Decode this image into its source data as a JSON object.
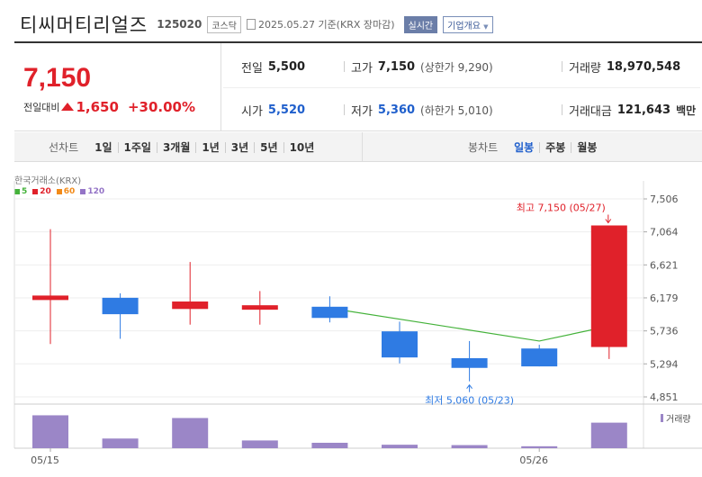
{
  "header": {
    "title": "티씨머티리얼즈",
    "code": "125020",
    "market": "코스닥",
    "date_text": "2025.05.27 기준(KRX 장마감)",
    "realtime_label": "실시간",
    "company_label": "기업개요"
  },
  "summary": {
    "price": "7,150",
    "change_label": "전일대비",
    "change_value": "1,650",
    "change_pct": "+30.00%",
    "prev_close_label": "전일",
    "prev_close": "5,500",
    "open_label": "시가",
    "open": "5,520",
    "high_label": "고가",
    "high": "7,150",
    "upper_limit": "(상한가 9,290)",
    "low_label": "저가",
    "low": "5,360",
    "lower_limit": "(하한가 5,010)",
    "volume_label": "거래량",
    "volume": "18,970,548",
    "amount_label": "거래대금",
    "amount": "121,643",
    "amount_unit": "백만"
  },
  "toolbar": {
    "line_label": "선차트",
    "line_items": [
      "1일",
      "1주일",
      "3개월",
      "1년",
      "3년",
      "5년",
      "10년"
    ],
    "candle_label": "봉차트",
    "candle_items": [
      "일봉",
      "주봉",
      "월봉"
    ],
    "candle_active": "일봉"
  },
  "colors": {
    "up": "#e0212a",
    "down": "#2f7be3",
    "ma5": "#44b23a",
    "ma20": "#e0212a",
    "ma60": "#f28a18",
    "ma120": "#9474c6",
    "volume": "#9b86c7"
  },
  "chart_data": {
    "type": "candlestick",
    "source_label": "한국거래소(KRX)",
    "ma_legend": [
      "5",
      "20",
      "60",
      "120"
    ],
    "volume_legend": "거래량",
    "y_ticks": [
      "7,506",
      "7,064",
      "6,621",
      "6,179",
      "5,736",
      "5,294",
      "4,851"
    ],
    "ylim": [
      4851,
      7506
    ],
    "x_labels": [
      {
        "index": 0,
        "label": "05/15"
      },
      {
        "index": 7,
        "label": "05/26"
      }
    ],
    "candles": [
      {
        "open": 6150,
        "close": 6210,
        "high": 7100,
        "low": 5560
      },
      {
        "open": 6180,
        "close": 5960,
        "high": 6240,
        "low": 5630
      },
      {
        "open": 6030,
        "close": 6130,
        "high": 6660,
        "low": 5820
      },
      {
        "open": 6020,
        "close": 6080,
        "high": 6270,
        "low": 5820
      },
      {
        "open": 6060,
        "close": 5910,
        "high": 6200,
        "low": 5850
      },
      {
        "open": 5730,
        "close": 5380,
        "high": 5860,
        "low": 5300
      },
      {
        "open": 5370,
        "close": 5240,
        "high": 5600,
        "low": 5060
      },
      {
        "open": 5500,
        "close": 5260,
        "high": 5550,
        "low": 5260
      },
      {
        "open": 5520,
        "close": 7150,
        "high": 7150,
        "low": 5360
      }
    ],
    "ma5": [
      null,
      null,
      null,
      null,
      6040,
      null,
      null,
      5600,
      5800
    ],
    "volumes": [
      0.85,
      0.25,
      0.78,
      0.2,
      0.14,
      0.09,
      0.08,
      0.05,
      0.66
    ],
    "annotations": {
      "high": "최고 7,150 (05/27)",
      "low": "최저 5,060 (05/23)"
    }
  }
}
